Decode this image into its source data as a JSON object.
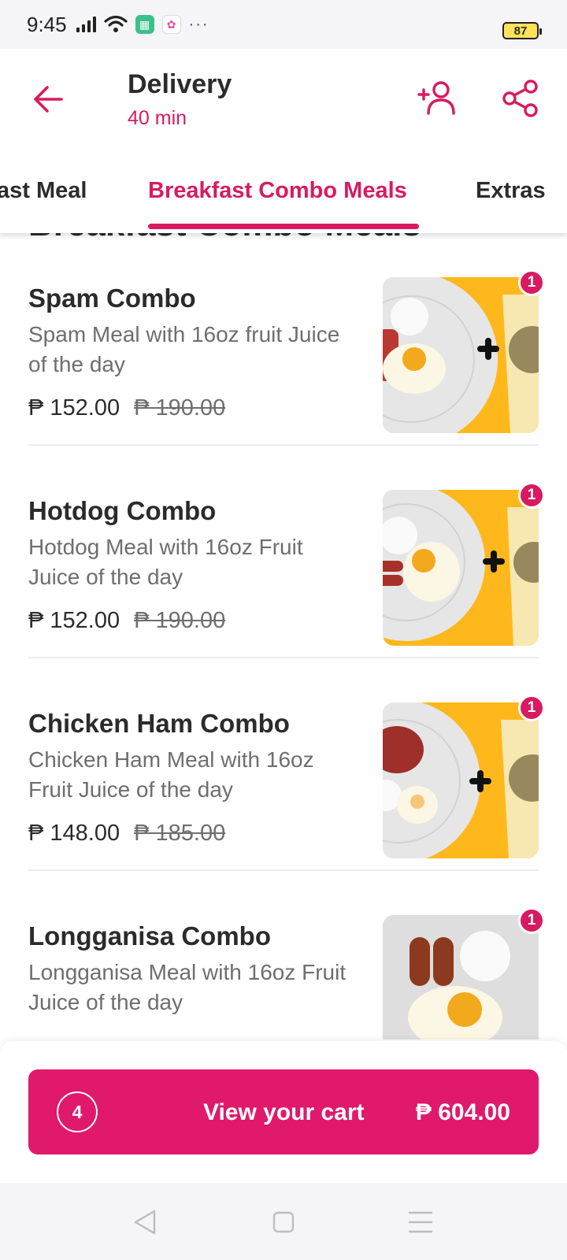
{
  "status_bar": {
    "time": "9:45",
    "battery": "87"
  },
  "header": {
    "title": "Delivery",
    "subtitle": "40 min"
  },
  "tabs": [
    {
      "label": "ast Meal"
    },
    {
      "label": "Breakfast Combo Meals"
    },
    {
      "label": "Extras"
    }
  ],
  "section": {
    "heading": "Breakfast Combo Meals"
  },
  "items": [
    {
      "name": "Spam Combo",
      "description": "Spam Meal with 16oz fruit Juice of the day",
      "price": "₱ 152.00",
      "old_price": "₱ 190.00",
      "qty": "1"
    },
    {
      "name": "Hotdog Combo",
      "description": "Hotdog Meal with 16oz Fruit Juice of the day",
      "price": "₱ 152.00",
      "old_price": "₱ 190.00",
      "qty": "1"
    },
    {
      "name": "Chicken Ham Combo",
      "description": "Chicken Ham Meal with 16oz Fruit Juice of the day",
      "price": "₱ 148.00",
      "old_price": "₱ 185.00",
      "qty": "1"
    },
    {
      "name": "Longganisa Combo",
      "description": "Longganisa Meal with 16oz Fruit Juice of the day",
      "price": "",
      "old_price": "",
      "qty": "1"
    }
  ],
  "cart": {
    "count": "4",
    "label": "View your cart",
    "total": "₱ 604.00"
  },
  "colors": {
    "accent": "#d81b60",
    "cart_button": "#e0196c",
    "thumb_background": "#ffb81c"
  }
}
